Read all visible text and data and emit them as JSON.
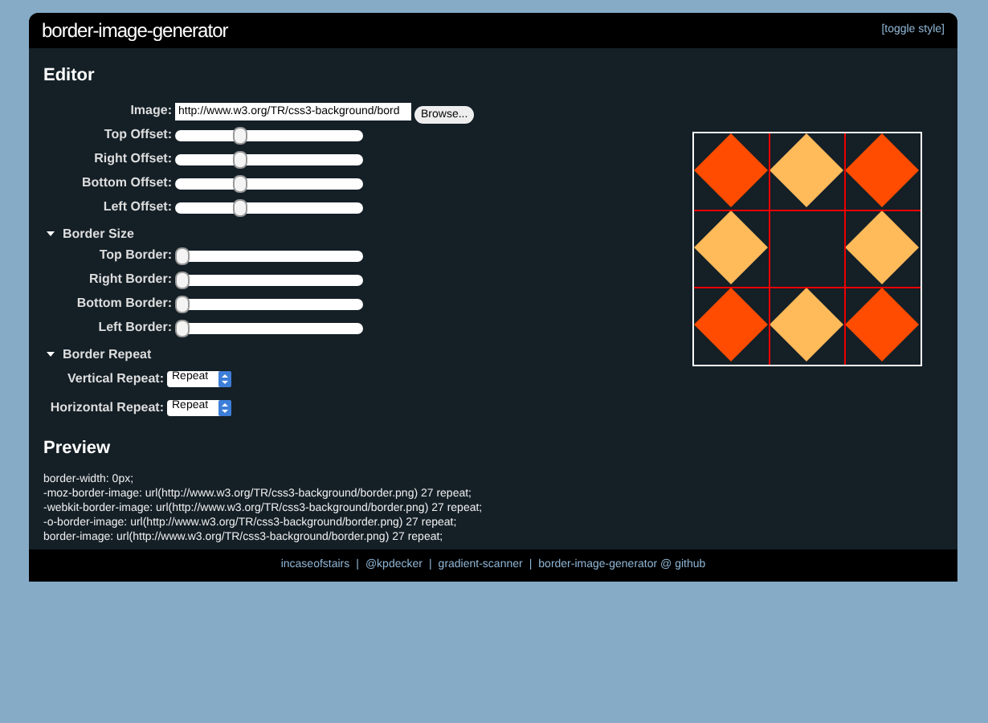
{
  "header": {
    "title": "border-image-generator",
    "toggle_link": "[toggle style]"
  },
  "editor": {
    "heading": "Editor",
    "image": {
      "label": "Image:",
      "value": "http://www.w3.org/TR/css3-background/bord",
      "button": "Browse..."
    },
    "offsets": [
      {
        "label": "Top Offset:",
        "level": 0.33
      },
      {
        "label": "Right Offset:",
        "level": 0.33
      },
      {
        "label": "Bottom Offset:",
        "level": 0.33
      },
      {
        "label": "Left Offset:",
        "level": 0.33
      }
    ],
    "border_size": {
      "title": "Border Size",
      "expanded": true,
      "sliders": [
        {
          "label": "Top Border:",
          "level": 0
        },
        {
          "label": "Right Border:",
          "level": 0
        },
        {
          "label": "Bottom Border:",
          "level": 0
        },
        {
          "label": "Left Border:",
          "level": 0
        }
      ]
    },
    "border_repeat": {
      "title": "Border Repeat",
      "expanded": true,
      "selects": [
        {
          "label": "Vertical Repeat:",
          "value": "Repeat"
        },
        {
          "label": "Horizontal Repeat:",
          "value": "Repeat"
        }
      ]
    }
  },
  "preview": {
    "heading": "Preview",
    "lines": [
      "border-width: 0px;",
      "-moz-border-image: url(http://www.w3.org/TR/css3-background/border.png) 27 repeat;",
      "-webkit-border-image: url(http://www.w3.org/TR/css3-background/border.png) 27 repeat;",
      "-o-border-image: url(http://www.w3.org/TR/css3-background/border.png) 27 repeat;",
      "border-image: url(http://www.w3.org/TR/css3-background/border.png) 27 repeat;"
    ]
  },
  "footer": {
    "links": [
      "incaseofstairs",
      "@kpdecker",
      "gradient-scanner",
      "border-image-generator @ github"
    ],
    "separator": "|"
  }
}
